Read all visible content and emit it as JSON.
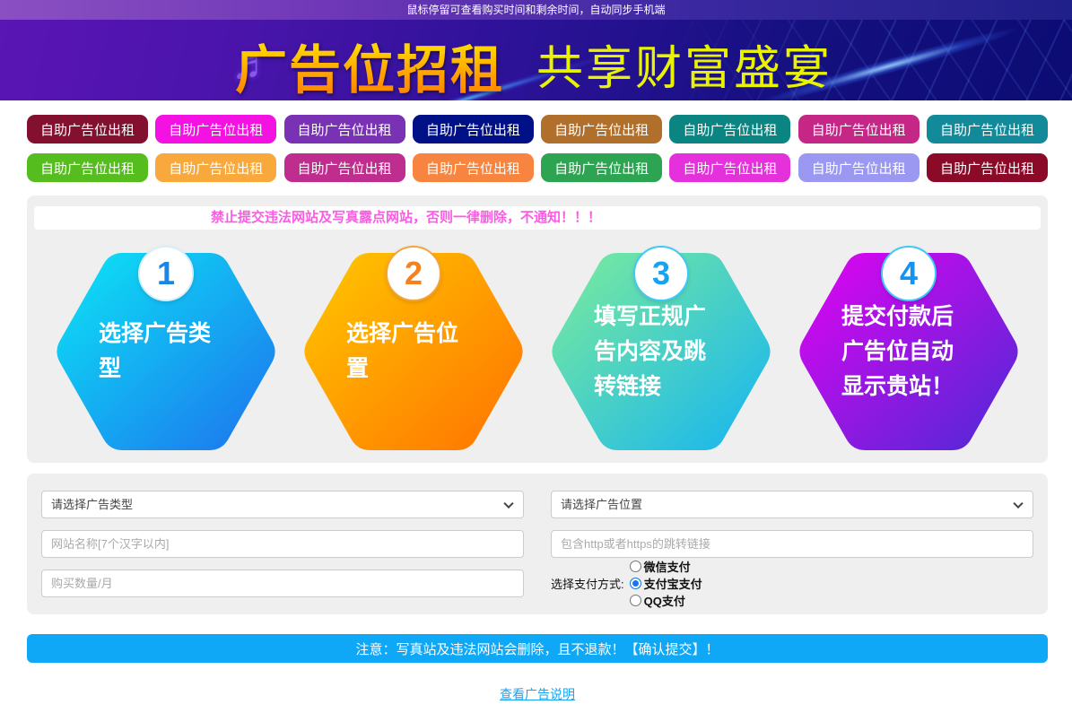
{
  "status_bar": {
    "text": "鼠标停留可查看购买时间和剩余时间，自动同步手机端"
  },
  "banner": {
    "title": "广告位招租",
    "slogan": "共享财富盛宴",
    "music_icon": "♬"
  },
  "ad_buttons": {
    "label": "自助广告位出租",
    "rows": [
      [
        "#83102f",
        "#f312e2",
        "#7a32b5",
        "#001087",
        "#b06f2b",
        "#0a8582",
        "#c42786",
        "#128a99"
      ],
      [
        "#55be1e",
        "#f9a83c",
        "#bf2d8e",
        "#f8853f",
        "#2da452",
        "#e431dc",
        "#9b98f2",
        "#8b0a28"
      ]
    ]
  },
  "warning": {
    "text": "禁止提交违法网站及写真露点网站，否则一律删除，不通知！！！",
    "color": "#fb5ce3"
  },
  "steps": [
    {
      "number": "1",
      "text": "选择广告类型",
      "gradient_from": "#0ce6f5",
      "gradient_to": "#1d72ee",
      "number_color": "#1888e8",
      "ring_color": "#d8eefb"
    },
    {
      "number": "2",
      "text": "选择广告位置",
      "gradient_from": "#ffc800",
      "gradient_to": "#ff7200",
      "number_color": "#f5821e",
      "ring_color": "#f3a43c"
    },
    {
      "number": "3",
      "text": "填写正规广告内容及跳转链接",
      "gradient_from": "#7dec9b",
      "gradient_to": "#14b4f2",
      "number_color": "#16a3f0",
      "ring_color": "#3ec9f6"
    },
    {
      "number": "4",
      "text": "提交付款后广告位自动显示贵站！",
      "gradient_from": "#e303f2",
      "gradient_to": "#4c2ad4",
      "number_color": "#1693f0",
      "ring_color": "#3ec9f6"
    }
  ],
  "form": {
    "type_select_value": "请选择广告类型",
    "position_select_value": "请选择广告位置",
    "site_name_placeholder": "网站名称[7个汉字以内]",
    "link_placeholder": "包含http或者https的跳转链接",
    "quantity_placeholder": "购买数量/月",
    "payment_label": "选择支付方式:",
    "payment_options": [
      {
        "label": "微信支付",
        "checked": false
      },
      {
        "label": "支付宝支付",
        "checked": true
      },
      {
        "label": "QQ支付",
        "checked": false
      }
    ]
  },
  "submit_bar": {
    "text": "注意：写真站及违法网站会删除，且不退款！【确认提交】！",
    "background": "#0ea8f7"
  },
  "footer_link": {
    "text": "查看广告说明",
    "color": "#18a6f2"
  }
}
